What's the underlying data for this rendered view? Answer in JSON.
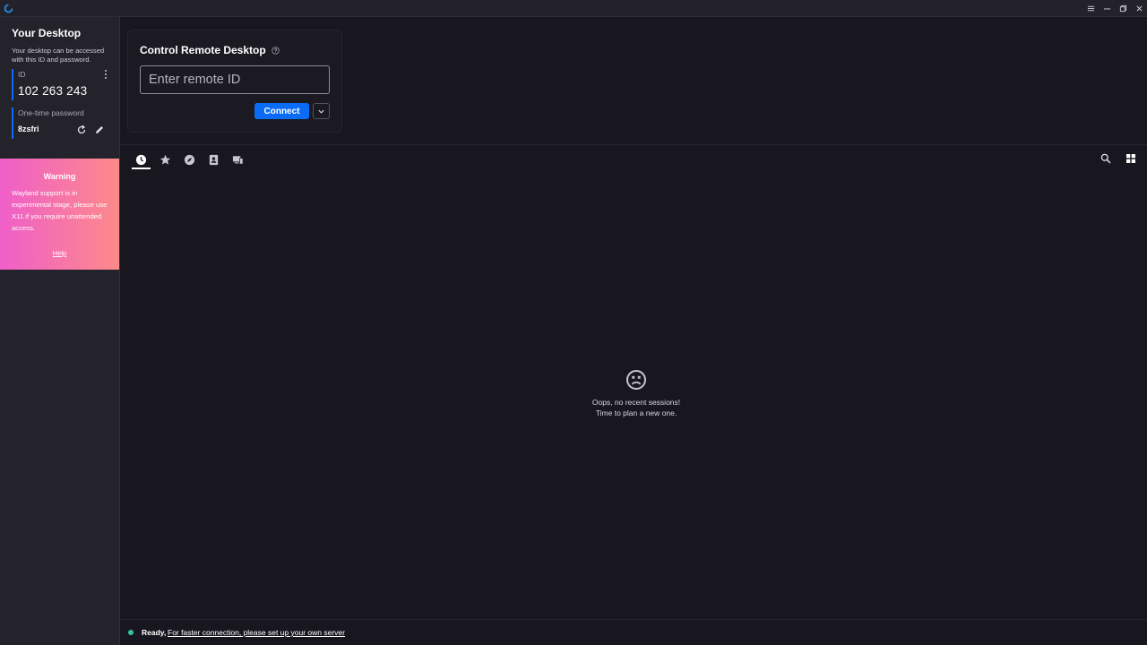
{
  "titlebar": {
    "logo_icon": "rustdesk-logo-icon",
    "controls": [
      "menu-icon",
      "minimize-icon",
      "restore-icon",
      "close-icon"
    ]
  },
  "sidebar": {
    "title": "Your Desktop",
    "description": "Your desktop can be accessed with this ID and password.",
    "id_label": "ID",
    "id_value": "102 263 243",
    "password_label": "One-time password",
    "password_value": "8zsfri"
  },
  "warning": {
    "title": "Warning",
    "text": "Wayland support is in experimental stage, please use X11 if you require unattended access.",
    "help_label": "Help"
  },
  "connect": {
    "title": "Control Remote Desktop",
    "input_placeholder": "Enter remote ID",
    "input_value": "",
    "connect_label": "Connect"
  },
  "tabs": [
    {
      "name": "recent-sessions",
      "icon": "clock-icon",
      "active": true
    },
    {
      "name": "favorites",
      "icon": "star-icon",
      "active": false
    },
    {
      "name": "discovered",
      "icon": "compass-icon",
      "active": false
    },
    {
      "name": "address-book",
      "icon": "contacts-icon",
      "active": false
    },
    {
      "name": "devices",
      "icon": "devices-icon",
      "active": false
    }
  ],
  "empty_state": {
    "line1": "Oops, no recent sessions!",
    "line2": "Time to plan a new one."
  },
  "status": {
    "ready_text": "Ready,",
    "link_text": "For faster connection, please set up your own server"
  },
  "colors": {
    "accent": "#0a6cf5",
    "status_ok": "#33c5a5",
    "warning_start": "#ef5fc9",
    "warning_end": "#fd8a8a"
  }
}
